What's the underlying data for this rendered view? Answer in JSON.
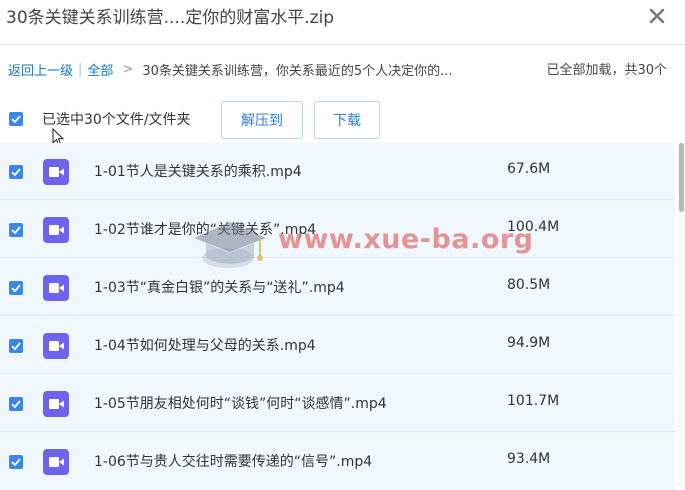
{
  "title": "30条关键关系训练营....定你的财富水平.zip",
  "breadcrumb": {
    "back": "返回上一级",
    "all": "全部",
    "current": "30条关键关系训练营，你关系最近的5个人决定你的..."
  },
  "status": "已全部加载，共30个",
  "selection": {
    "label": "已选中30个文件/文件夹",
    "extract_label": "解压到",
    "download_label": "下载"
  },
  "files": [
    {
      "name": "1-01节人是关键关系的乘积.mp4",
      "size": "67.6M",
      "checked": true
    },
    {
      "name": "1-02节谁才是你的“关键关系”.mp4",
      "size": "100.4M",
      "checked": true
    },
    {
      "name": "1-03节“真金白银”的关系与“送礼”.mp4",
      "size": "80.5M",
      "checked": true
    },
    {
      "name": "1-04节如何处理与父母的关系.mp4",
      "size": "94.9M",
      "checked": true
    },
    {
      "name": "1-05节朋友相处何时“谈钱”何时“谈感情”.mp4",
      "size": "101.7M",
      "checked": true
    },
    {
      "name": "1-06节与贵人交往时需要传递的“信号”.mp4",
      "size": "93.4M",
      "checked": true
    }
  ],
  "watermark": "www.xue-ba.org",
  "icons": {
    "close": "close-icon",
    "file": "video-file-icon",
    "check": "check-icon"
  },
  "colors": {
    "accent": "#3a87e6",
    "link": "#1a73c8",
    "row_bg": "#f0f7fd",
    "video_icon": "#6e63ee",
    "watermark": "#e27878"
  }
}
